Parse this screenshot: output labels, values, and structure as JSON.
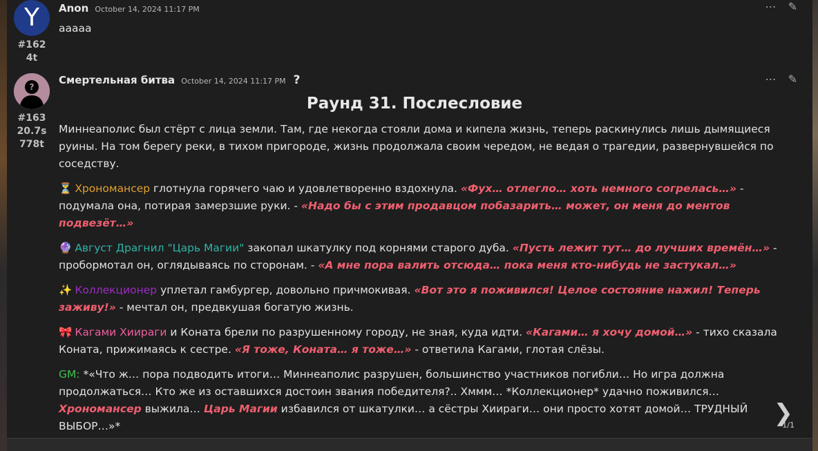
{
  "post1": {
    "avatar_letter": "Y",
    "avatar_color": "#1f3b8a",
    "username": "Anon",
    "date": "October 14, 2024 11:17 PM",
    "number": "#162",
    "stat1": "4t",
    "text": "aaaaa"
  },
  "post2": {
    "username": "Смертельная битва",
    "date": "October 14, 2024 11:17 PM",
    "help_mark": "?",
    "number": "#163",
    "stat1": "20.7s",
    "stat2": "778t",
    "title": "Раунд 31. Послесловие",
    "intro": "Миннеаполис был стёрт с лица земли. Там, где некогда стояли дома и кипела жизнь, теперь раскинулись лишь дымящиеся руины. На том берегу реки, в тихом пригороде, жизнь продолжала своим чередом, не ведая о трагедии, развернувшейся по соседству.",
    "p1": {
      "emoji": "⏳",
      "name": "Хрономансер",
      "t1": " глотнула горячего чаю и удовлетворенно вздохнула. ",
      "q1": "«Фух… отлегло… хоть немного согрелась…»",
      "t2": " - подумала она, потирая замерзшие руки. - ",
      "q2": "«Надо бы с этим продавцом побазарить… может, он меня до ментов подвезёт…»"
    },
    "p2": {
      "emoji": "🔮",
      "name": "Август Драгнил \"Царь Магии\"",
      "t1": " закопал шкатулку под корнями старого дуба. ",
      "q1": "«Пусть лежит тут… до лучших времён…»",
      "t2": " - пробормотал он, оглядываясь по сторонам. - ",
      "q2": "«А мне пора валить отсюда… пока меня кто-нибудь не застукал…»"
    },
    "p3": {
      "emoji": "✨",
      "name": "Коллекционер",
      "t1": " уплетал гамбургер, довольно причмокивая. ",
      "q1": "«Вот это я поживился! Целое состояние нажил! Теперь заживу!»",
      "t2": " - мечтал он, предвкушая богатую жизнь."
    },
    "p4": {
      "emoji": "🎀",
      "name": "Кагами Хиираги",
      "t1": " и Коната брели по разрушенному городу, не зная, куда идти. ",
      "q1": "«Кагами… я хочу домой…»",
      "t2": " - тихо сказала Коната, прижимаясь к сестре. ",
      "q2": "«Я тоже, Коната… я тоже…»",
      "t3": " - ответила Кагами, глотая слёзы."
    },
    "p5": {
      "gm": "GM:",
      "t1": " *«Что ж… пора подводить итоги… Миннеаполис разрушен, большинство участников погибли… Но игра должна продолжаться… Кто же из оставшихся достоин звания победителя?.. Хммм… *Коллекционер* удачно поживился… ",
      "n1": "Хрономансер",
      "t2": " выжила… ",
      "n2": "Царь Магии",
      "t3": " избавился от шкатулки… а сёстры Хиираги… они просто хотят домой… ТРУДНЫЙ ВЫБОР…»*"
    }
  },
  "pager": {
    "next_icon": "chevron-right-icon",
    "page": "1/1"
  },
  "icons": {
    "more": "⋯",
    "edit": "✎"
  },
  "colors": {
    "quote": "#ef5f6f",
    "chronomancer": "#e0a030",
    "august": "#2fb3a4",
    "collector": "#9c2cc4",
    "kagami": "#ef5f9f",
    "gm": "#3fbf4f"
  }
}
